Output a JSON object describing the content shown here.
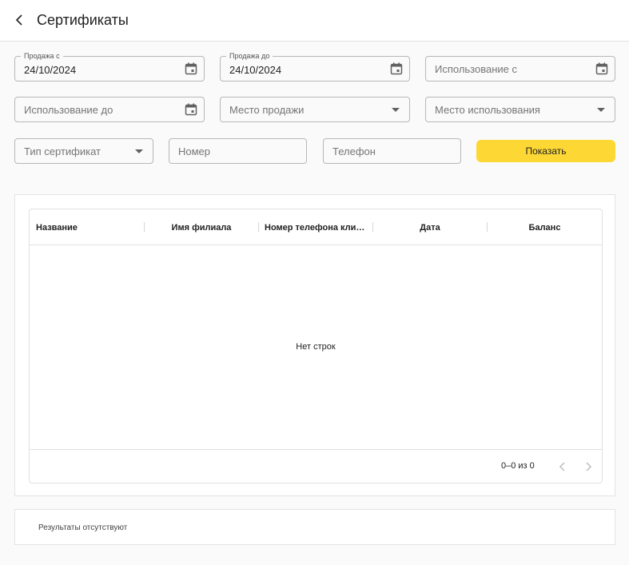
{
  "header": {
    "title": "Сертификаты",
    "back_icon": "chevron-left-icon"
  },
  "filters": {
    "sale_from": {
      "label": "Продажа с",
      "value": "24/10/2024",
      "icon": "calendar-icon"
    },
    "sale_to": {
      "label": "Продажа до",
      "value": "24/10/2024",
      "icon": "calendar-icon"
    },
    "usage_from": {
      "placeholder": "Использование с",
      "icon": "calendar-icon"
    },
    "usage_to": {
      "placeholder": "Использование до",
      "icon": "calendar-icon"
    },
    "sale_place": {
      "placeholder": "Место продажи"
    },
    "usage_place": {
      "placeholder": "Место использования"
    },
    "cert_type": {
      "placeholder": "Тип сертификат"
    },
    "number": {
      "placeholder": "Номер"
    },
    "phone": {
      "placeholder": "Телефон"
    },
    "show_button": "Показать",
    "accent_color": "#fdd835"
  },
  "table": {
    "columns": [
      "Название",
      "Имя филиала",
      "Номер телефона клиента",
      "Дата",
      "Баланс"
    ],
    "empty_text": "Нет строк",
    "pagination": "0–0 из 0"
  },
  "results": {
    "text": "Результаты отсутствуют"
  }
}
